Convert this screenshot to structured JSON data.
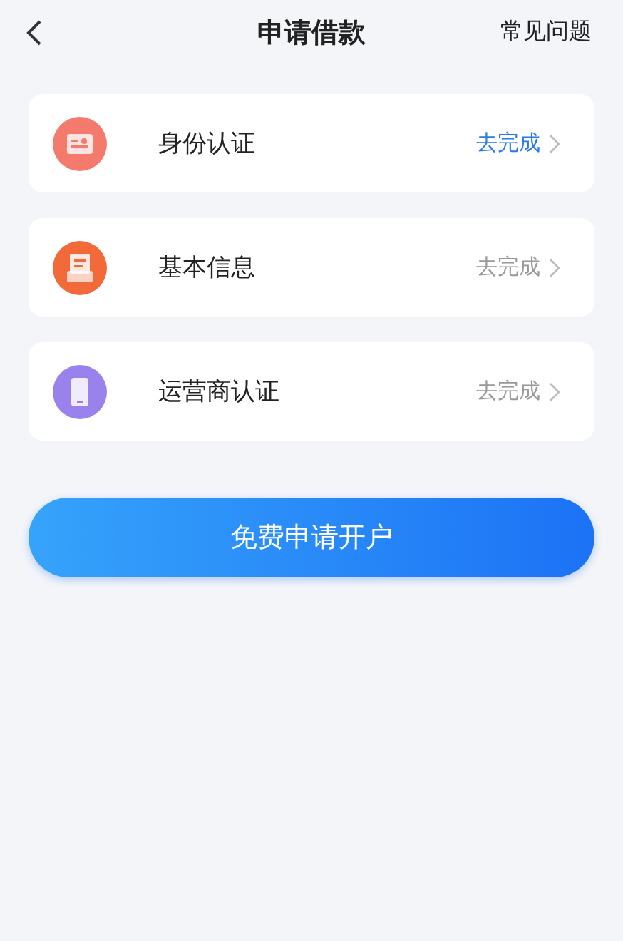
{
  "header": {
    "title": "申请借款",
    "help": "常见问题"
  },
  "steps": [
    {
      "kind": "id-card",
      "label": "身份认证",
      "action": "去完成",
      "active": true,
      "color": "#f47a6c"
    },
    {
      "kind": "form",
      "label": "基本信息",
      "action": "去完成",
      "active": false,
      "color": "#f26a3a"
    },
    {
      "kind": "phone",
      "label": "运营商认证",
      "action": "去完成",
      "active": false,
      "color": "#9a82ec"
    }
  ],
  "submit": "免费申请开户"
}
